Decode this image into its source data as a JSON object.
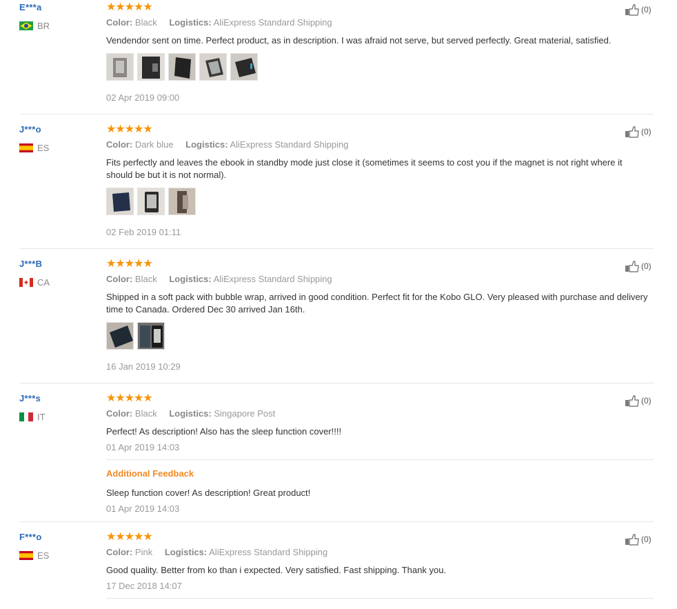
{
  "reviews": [
    {
      "name": "E***a",
      "country": "BR",
      "flag": "br-flag",
      "rating": 5,
      "stars": "★★★★★",
      "color_label": "Color:",
      "color": "Black",
      "logistics_label": "Logistics:",
      "logistics": "AliExpress Standard Shipping",
      "text": "Vendendor sent on time. Perfect product, as in description. I was afraid not serve, but served perfectly. Great material, satisfied.",
      "date": "02 Apr 2019 09:00",
      "likes": "(0)"
    },
    {
      "name": "J***o",
      "country": "ES",
      "flag": "es-flag",
      "rating": 5,
      "stars": "★★★★★",
      "color_label": "Color:",
      "color": "Dark blue",
      "logistics_label": "Logistics:",
      "logistics": "AliExpress Standard Shipping",
      "text": "Fits perfectly and leaves the ebook in standby mode just close it (sometimes it seems to cost you if the magnet is not right where it should be but it is not normal).",
      "date": "02 Feb 2019 01:11",
      "likes": "(0)"
    },
    {
      "name": "J***B",
      "country": "CA",
      "flag": "ca-flag",
      "rating": 5,
      "stars": "★★★★★",
      "color_label": "Color:",
      "color": "Black",
      "logistics_label": "Logistics:",
      "logistics": "AliExpress Standard Shipping",
      "text": "Shipped in a soft pack with bubble wrap, arrived in good condition. Perfect fit for the Kobo GLO. Very pleased with purchase and delivery time to Canada. Ordered Dec 30 arrived Jan 16th.",
      "date": "16 Jan 2019 10:29",
      "likes": "(0)"
    },
    {
      "name": "J***s",
      "country": "IT",
      "flag": "it-flag",
      "rating": 5,
      "stars": "★★★★★",
      "color_label": "Color:",
      "color": "Black",
      "logistics_label": "Logistics:",
      "logistics": "Singapore Post",
      "text": "Perfect! As description! Also has the sleep function cover!!!!",
      "date": "01 Apr 2019 14:03",
      "additional_title": "Additional Feedback",
      "additional_text": "Sleep function cover! As description! Great product!",
      "additional_date": "01 Apr 2019 14:03",
      "likes": "(0)"
    },
    {
      "name": "F***o",
      "country": "ES",
      "flag": "es-flag",
      "rating": 5,
      "stars": "★★★★★",
      "color_label": "Color:",
      "color": "Pink",
      "logistics_label": "Logistics:",
      "logistics": "AliExpress Standard Shipping",
      "text": "Good quality. Better from ko than i expected. Very satisfied. Fast shipping. Thank you.",
      "date": "17 Dec 2018 14:07",
      "likes": "(0)"
    }
  ],
  "colors": {
    "name": "#2d6ab5",
    "star": "#f79407",
    "additional": "#f08a24",
    "muted": "#999999"
  }
}
